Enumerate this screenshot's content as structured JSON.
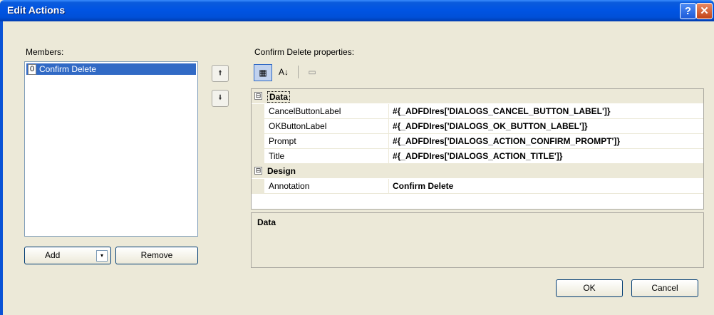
{
  "window": {
    "title": "Edit Actions",
    "help_glyph": "?",
    "close_glyph": "✕"
  },
  "members": {
    "label": "Members:",
    "items": [
      {
        "index": "0",
        "label": "Confirm Delete",
        "selected": true
      }
    ],
    "move_up_glyph": "🠙",
    "move_down_glyph": "🠛"
  },
  "buttons": {
    "add": "Add",
    "add_caret": "▾",
    "remove": "Remove",
    "ok": "OK",
    "cancel": "Cancel"
  },
  "properties": {
    "label": "Confirm Delete properties:",
    "toolbar": [
      {
        "icon": "categorized-icon",
        "glyph": "▦"
      },
      {
        "icon": "alphabetical-icon",
        "glyph": "A↓"
      },
      {
        "icon": "property-pages-icon",
        "glyph": "▭"
      }
    ],
    "categories": [
      {
        "name": "Data",
        "toggle": "⊟",
        "rows": [
          {
            "name": "CancelButtonLabel",
            "value": "#{_ADFDIres['DIALOGS_CANCEL_BUTTON_LABEL']}"
          },
          {
            "name": "OKButtonLabel",
            "value": "#{_ADFDIres['DIALOGS_OK_BUTTON_LABEL']}"
          },
          {
            "name": "Prompt",
            "value": "#{_ADFDIres['DIALOGS_ACTION_CONFIRM_PROMPT']}"
          },
          {
            "name": "Title",
            "value": "#{_ADFDIres['DIALOGS_ACTION_TITLE']}"
          }
        ]
      },
      {
        "name": "Design",
        "toggle": "⊟",
        "rows": [
          {
            "name": "Annotation",
            "value": "Confirm Delete"
          }
        ]
      }
    ],
    "description_title": "Data"
  }
}
